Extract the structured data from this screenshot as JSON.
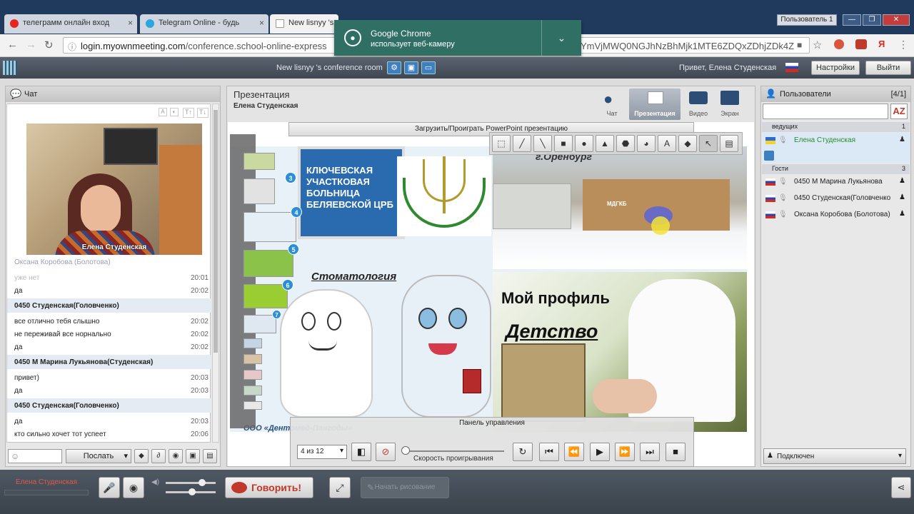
{
  "browser": {
    "tabs": [
      {
        "title": "телеграмм онлайн вход",
        "close": "×"
      },
      {
        "title": "Telegram Online - будь",
        "close": "×"
      },
      {
        "title": "New lisnyy 's",
        "close": "×"
      }
    ],
    "profile": "Пользователь 1",
    "window_controls": [
      "—",
      "❐",
      "✕"
    ],
    "url_domain": "login.myownmeeting.com",
    "url_path": "/conference.school-online-express",
    "url_tail": "YmVjMWQ0NGJhNzBhMjk1MTE6ZDQxZDhjZDk4Z",
    "notification": {
      "title": "Google Chrome",
      "text": "использует веб-камеру"
    }
  },
  "app": {
    "conference_name": "New lisnyy 's conference room",
    "greeting": "Привет, Елена  Студенская",
    "settings_label": "Настройки",
    "exit_label": "Выйти"
  },
  "chat": {
    "title": "Чат",
    "video_label": "Елена  Студенская",
    "top_author": "Оксана Коробова (Болотова)",
    "messages": [
      {
        "text": "уже нет",
        "time": "20:01"
      },
      {
        "text": "да",
        "time": "20:02"
      },
      {
        "author": "0450 Студенская(Головченко)"
      },
      {
        "text": "все отлично тебя слышно",
        "time": "20:02"
      },
      {
        "text": "не переживай все норнально",
        "time": "20:02"
      },
      {
        "text": "да",
        "time": "20:02"
      },
      {
        "author": "0450 М Марина Лукьянова(Студенская)"
      },
      {
        "text": "привет)",
        "time": "20:03"
      },
      {
        "text": "да",
        "time": "20:03"
      },
      {
        "author": "0450 Студенская(Головченко)"
      },
      {
        "text": "да",
        "time": "20:03"
      },
      {
        "text": "кто сильно хочет тот успеет",
        "time": "20:06"
      }
    ],
    "send_label": "Послать"
  },
  "presentation": {
    "title": "Презентация",
    "presenter": "Елена  Студенская",
    "modes": [
      "Чат",
      "Презентация",
      "Видео",
      "Экран"
    ],
    "upload_label": "Загрузить/Проиграть PowerPoint презентацию",
    "slide_texts": {
      "city": "г.Оренбург",
      "hospital": "КЛЮЧЕВСКАЯ УЧАСТКОВАЯ БОЛЬНИЦА БЕЛЯЕВСКОЙ ЦРБ",
      "dentistry": "Стоматология",
      "profile": "Мой профиль",
      "childhood": "Детство",
      "company": "ООО «Дентомед-Пангоды»",
      "mdgkb": "МДГКБ"
    },
    "thumb_numbers": [
      "3",
      "4",
      "5",
      "6",
      "7"
    ],
    "control_panel_label": "Панель управления",
    "page_indicator": "4 из 12",
    "speed_label": "Скорость проигрывания"
  },
  "users": {
    "title": "Пользователи",
    "count": "[4/1]",
    "host_section": "ведущих",
    "host_count": "1",
    "host": "Елена  Студенская",
    "guest_section": "Гости",
    "guest_count": "3",
    "guests": [
      "0450 М Марина Лукьянова",
      "0450 Студенская(Головченко",
      "Оксана Коробова (Болотова)"
    ],
    "status": "Подключен"
  },
  "bottom": {
    "user_name": "Елена  Студенская",
    "talk_label": "Говорить!",
    "draw_label": "Начать рисование"
  },
  "colors": {
    "accent": "#3d7fc1",
    "talk": "#c0392b",
    "notification": "#2f6f64"
  }
}
